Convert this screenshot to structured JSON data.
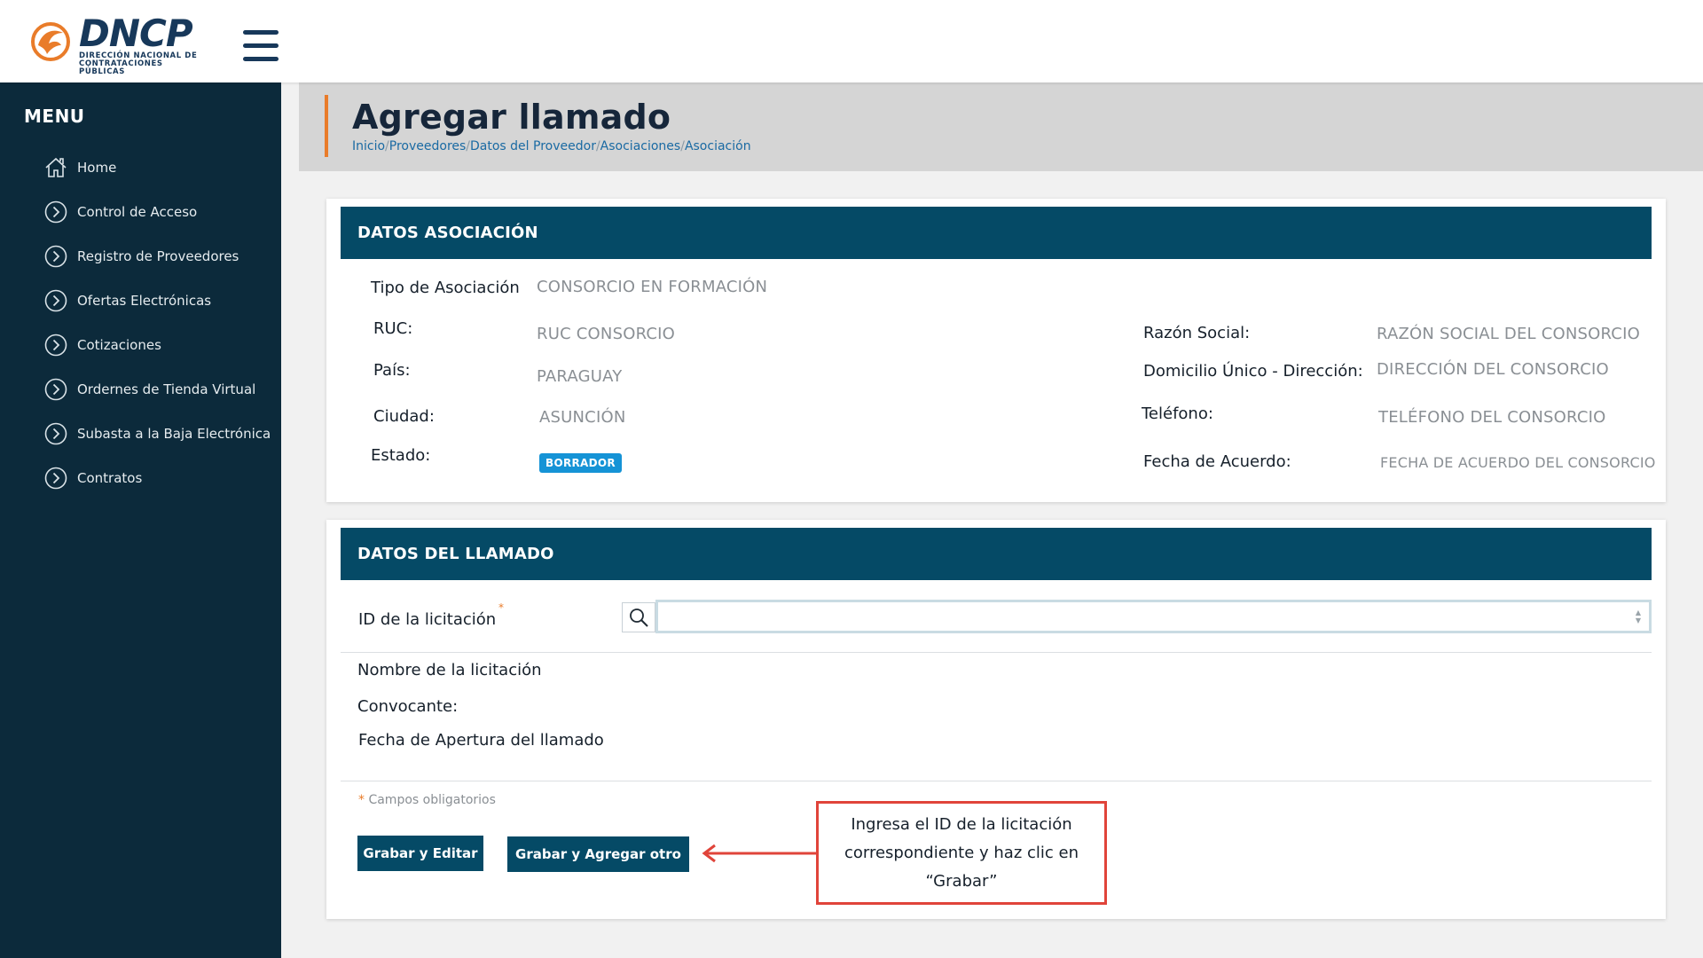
{
  "brand": {
    "logo_word": "DNCP",
    "logo_subtitle": "DIRECCIÓN NACIONAL DE\nCONTRATACIONES PÚBLICAS",
    "accent_color": "#e97c2a",
    "navy_color": "#0c2a3b"
  },
  "sidebar": {
    "title": "MENU",
    "items": [
      {
        "label": "Home",
        "icon": "home-icon"
      },
      {
        "label": "Control de Acceso",
        "icon": "chevron-right-circle-icon"
      },
      {
        "label": "Registro de Proveedores",
        "icon": "chevron-right-circle-icon"
      },
      {
        "label": "Ofertas Electrónicas",
        "icon": "chevron-right-circle-icon"
      },
      {
        "label": "Cotizaciones",
        "icon": "chevron-right-circle-icon"
      },
      {
        "label": "Ordernes de Tienda Virtual",
        "icon": "chevron-right-circle-icon"
      },
      {
        "label": "Subasta a la Baja Electrónica",
        "icon": "chevron-right-circle-icon"
      },
      {
        "label": "Contratos",
        "icon": "chevron-right-circle-icon"
      }
    ]
  },
  "header": {
    "title": "Agregar llamado",
    "breadcrumb": [
      "Inicio",
      "Proveedores",
      "Datos del Proveedor",
      "Asociaciones",
      "Asociación"
    ],
    "separator": "/"
  },
  "asociacion": {
    "section_title": "DATOS ASOCIACIÓN",
    "tipo_label": "Tipo de Asociación",
    "tipo_value": "CONSORCIO EN FORMACIÓN",
    "ruc_label": "RUC:",
    "ruc_value": "RUC CONSORCIO",
    "pais_label": "País:",
    "pais_value": "PARAGUAY",
    "ciudad_label": "Ciudad:",
    "ciudad_value": "ASUNCIÓN",
    "estado_label": "Estado:",
    "estado_value": "BORRADOR",
    "razon_label": "Razón Social:",
    "razon_value": "RAZÓN SOCIAL DEL CONSORCIO",
    "domicilio_label": "Domicilio Único - Dirección:",
    "domicilio_value": "DIRECCIÓN DEL CONSORCIO",
    "telefono_label": "Teléfono:",
    "telefono_value": "TELÉFONO DEL CONSORCIO",
    "fecha_label": "Fecha de Acuerdo:",
    "fecha_value": "FECHA DE ACUERDO DEL CONSORCIO"
  },
  "llamado": {
    "section_title": "DATOS DEL LLAMADO",
    "id_label": "ID de la licitación",
    "required_mark": "*",
    "id_value": "",
    "nombre_label": "Nombre de la licitación",
    "convocante_label": "Convocante:",
    "fecha_label": "Fecha de Apertura del llamado",
    "required_note": "Campos obligatorios",
    "save_edit_label": "Grabar y Editar",
    "save_add_label": "Grabar y Agregar otro"
  },
  "annotation": {
    "text": "Ingresa el ID de la licitación correspondiente y haz clic en “Grabar”",
    "border_color": "#e0443a"
  }
}
